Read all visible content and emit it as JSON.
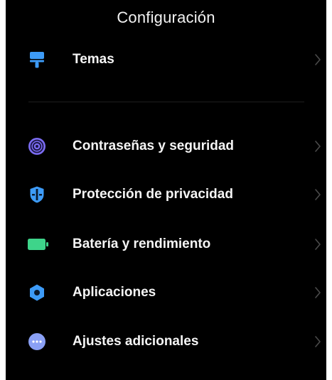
{
  "header": {
    "title": "Configuración"
  },
  "settings_items": [
    {
      "label": "Temas",
      "icon": "paintbrush-icon",
      "color": "#3d9bf7"
    },
    {
      "label": "Contraseñas y seguridad",
      "icon": "fingerprint-icon",
      "color": "#7b6cf2"
    },
    {
      "label": "Protección de privacidad",
      "icon": "shield-icon",
      "color": "#3d9bf7"
    },
    {
      "label": "Batería y rendimiento",
      "icon": "battery-icon",
      "color": "#3ed48a"
    },
    {
      "label": "Aplicaciones",
      "icon": "gear-icon",
      "color": "#3d9bf7"
    },
    {
      "label": "Ajustes adicionales",
      "icon": "more-dots-icon",
      "color": "#8aa0f5"
    }
  ],
  "colors": {
    "background": "#000000",
    "text": "#f5f5f5",
    "chevron": "#4a4a4a"
  }
}
